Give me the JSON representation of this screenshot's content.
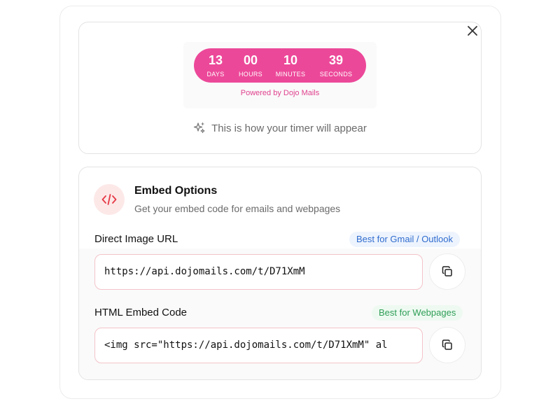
{
  "preview": {
    "close_icon": "close-icon",
    "timer": {
      "color": "#ec4899",
      "units": [
        {
          "value": "13",
          "label": "DAYS"
        },
        {
          "value": "00",
          "label": "HOURS"
        },
        {
          "value": "10",
          "label": "MINUTES"
        },
        {
          "value": "39",
          "label": "SECONDS"
        }
      ]
    },
    "powered_by": "Powered by Dojo Mails",
    "appear_icon": "sparkles-icon",
    "appear_text": "This is how your timer will appear"
  },
  "embed": {
    "icon": "code-icon",
    "title": "Embed Options",
    "subtitle": "Get your embed code for emails and webpages",
    "direct": {
      "label": "Direct Image URL",
      "badge": "Best for Gmail / Outlook",
      "value": "https://api.dojomails.com/t/D71XmM",
      "copy_icon": "copy-icon"
    },
    "html": {
      "label": "HTML Embed Code",
      "badge": "Best for Webpages",
      "value": "<img src=\"https://api.dojomails.com/t/D71XmM\" al",
      "copy_icon": "copy-icon"
    }
  }
}
